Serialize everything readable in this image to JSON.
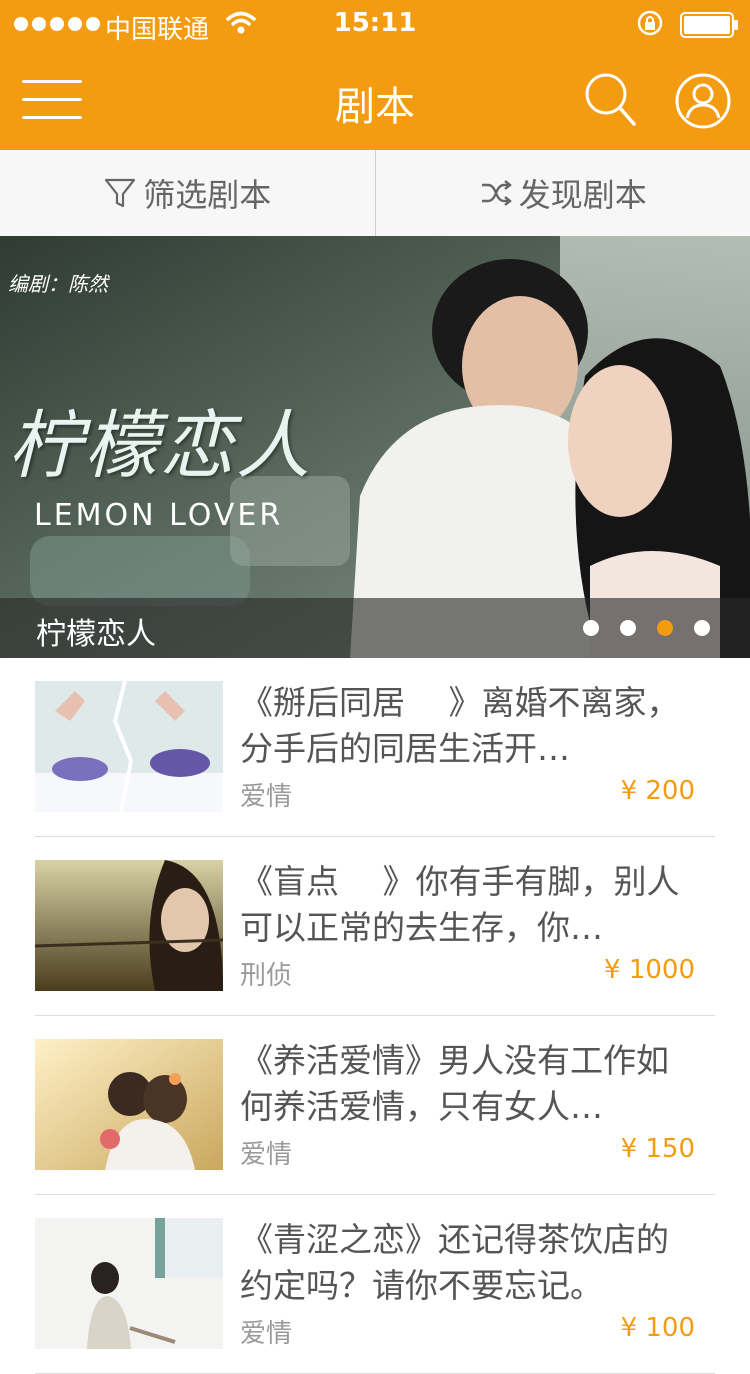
{
  "status_bar": {
    "carrier": "中国联通",
    "time": "15:11"
  },
  "header": {
    "title": "剧本",
    "menu_icon": "hamburger-menu-icon",
    "search_icon": "search-icon",
    "user_icon": "user-avatar-icon"
  },
  "filters": [
    {
      "icon": "filter-funnel-icon",
      "label": "筛选剧本"
    },
    {
      "icon": "shuffle-icon",
      "label": "发现剧本"
    }
  ],
  "banner": {
    "credit": "编剧：陈然",
    "art_title": "柠檬恋人",
    "art_subtitle": "LEMON LOVER",
    "caption": "柠檬恋人",
    "dots_total": 4,
    "dots_active_index": 2
  },
  "scripts": [
    {
      "title": "《掰后同居　 》离婚不离家，分手后的同居生活开…",
      "tag": "爱情",
      "price": "¥ 200"
    },
    {
      "title": "《盲点　 》你有手有脚，别人可以正常的去生存，你…",
      "tag": "刑侦",
      "price": "¥ 1000"
    },
    {
      "title": "《养活爱情》男人没有工作如何养活爱情，只有女人…",
      "tag": "爱情",
      "price": "¥ 150"
    },
    {
      "title": "《青涩之恋》还记得茶饮店的约定吗？请你不要忘记。",
      "tag": "爱情",
      "price": "¥ 100"
    }
  ],
  "colors": {
    "accent": "#f39c12",
    "text": "#555555",
    "muted": "#9a9a9a"
  }
}
